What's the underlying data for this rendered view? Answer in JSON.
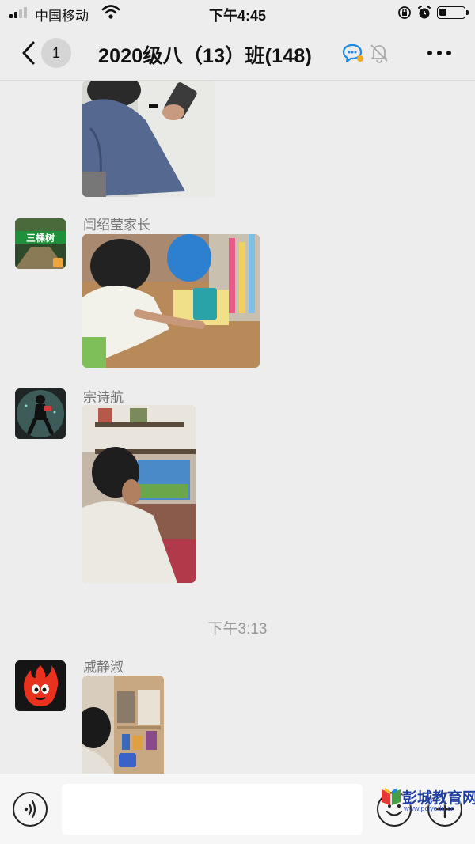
{
  "status_bar": {
    "carrier": "中国移动",
    "time": "下午4:45",
    "signal_bars_filled": 2,
    "signal_bars_total": 4,
    "battery_level_percent": 30
  },
  "nav": {
    "unread_count": "1",
    "title": "2020级八（13）班(148)",
    "icons": [
      "back-chevron-icon",
      "chat-bubble-icon",
      "mute-bell-icon",
      "more-dots-icon"
    ]
  },
  "messages": [
    {
      "sender": "",
      "type": "image",
      "description_icon": "photo"
    },
    {
      "sender": "闫绍莹家长",
      "type": "image",
      "avatar_text": "三棵树"
    },
    {
      "sender": "宗诗航",
      "type": "image"
    },
    {
      "timestamp": "下午3:13"
    },
    {
      "sender": "戚静淑",
      "type": "image"
    }
  ],
  "watermark": {
    "title": "彭城教育网",
    "url": "www.pcjyedu.cn"
  },
  "colors": {
    "background": "#ededed",
    "accent_blue": "#1e88e5",
    "muted_text": "#999999"
  }
}
